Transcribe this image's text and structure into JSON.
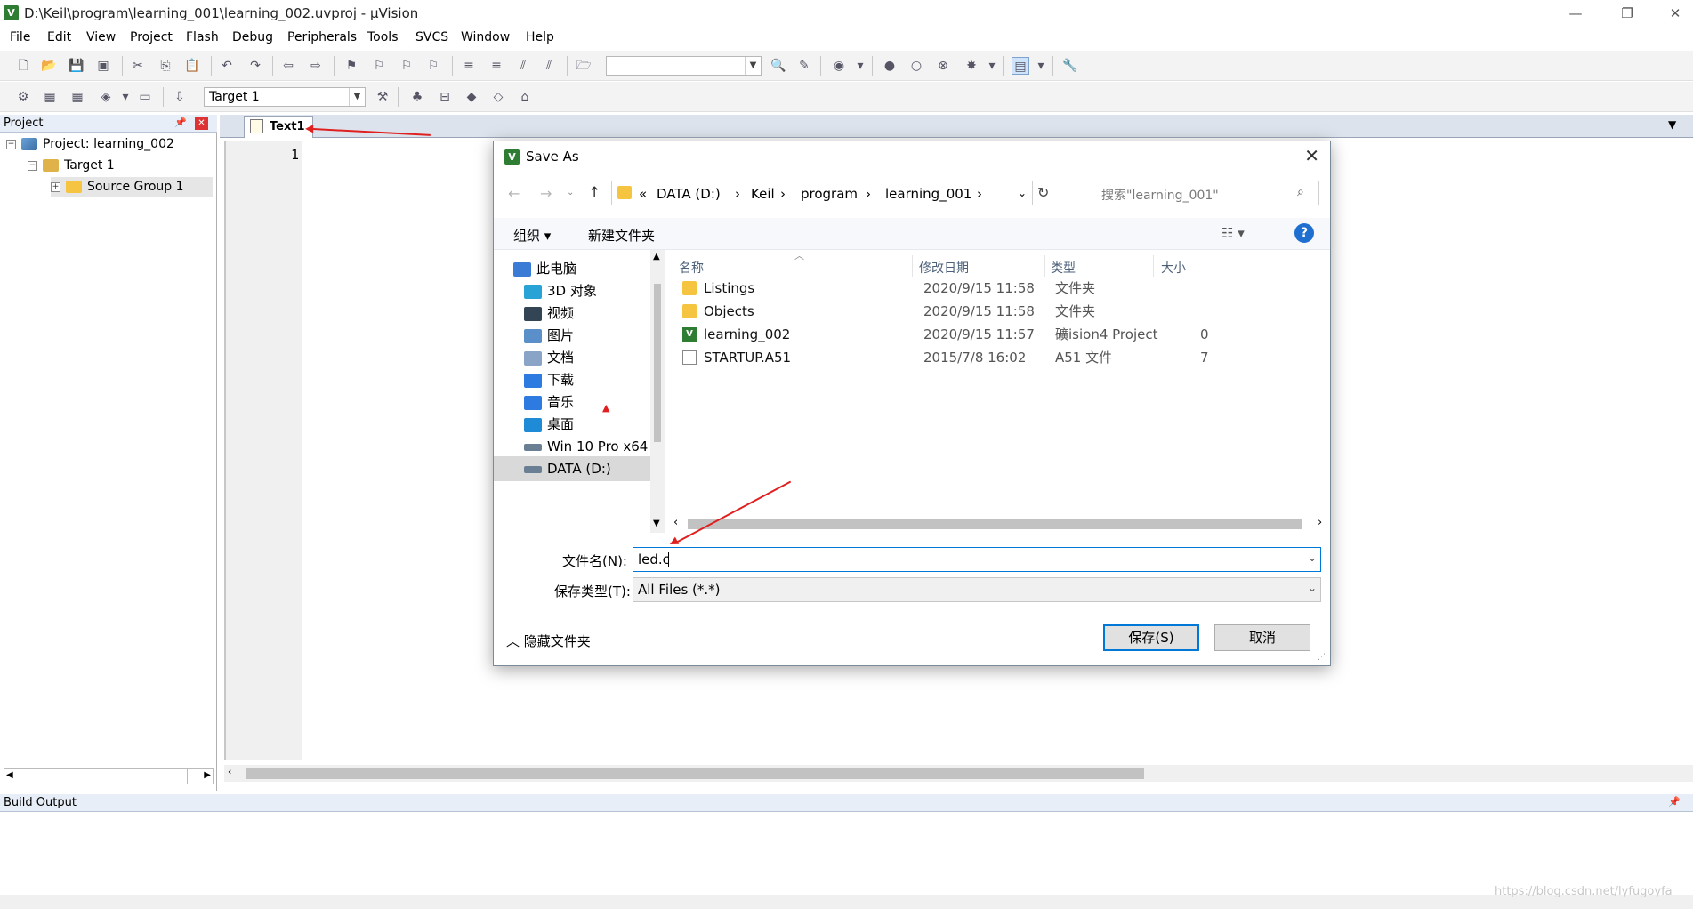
{
  "window": {
    "title": "D:\\Keil\\program\\learning_001\\learning_002.uvproj - µVision",
    "app_icon": "V",
    "controls": [
      "—",
      "❐",
      "✕"
    ]
  },
  "menu": [
    "File",
    "Edit",
    "View",
    "Project",
    "Flash",
    "Debug",
    "Peripherals",
    "Tools",
    "SVCS",
    "Window",
    "Help"
  ],
  "toolbar2": {
    "target_select": "Target 1"
  },
  "project_panel": {
    "title": "Project",
    "pin": "📌",
    "close": "✕",
    "tree": [
      {
        "label": "Project: learning_002",
        "expander": "−"
      },
      {
        "label": "Target 1",
        "expander": "−"
      },
      {
        "label": "Source Group 1",
        "expander": "+"
      }
    ]
  },
  "editor": {
    "tab_label": "Text1",
    "line_numbers": [
      "1"
    ]
  },
  "build_output": {
    "title": "Build Output"
  },
  "dialog": {
    "title": "Save As",
    "breadcrumb": [
      "«",
      "DATA (D:)",
      "›",
      "Keil",
      "›",
      "program",
      "›",
      "learning_001",
      "›"
    ],
    "search_placeholder": "搜索\"learning_001\"",
    "organize_label": "组织 ▾",
    "new_folder_label": "新建文件夹",
    "help_icon": "?",
    "nav_items": [
      {
        "label": "此电脑",
        "icon": "computer-icon",
        "color": "#3a7bd5"
      },
      {
        "label": "3D 对象",
        "icon": "cube-icon",
        "color": "#29a3d6"
      },
      {
        "label": "视频",
        "icon": "video-icon",
        "color": "#334455"
      },
      {
        "label": "图片",
        "icon": "picture-icon",
        "color": "#5b8fc9"
      },
      {
        "label": "文档",
        "icon": "document-icon",
        "color": "#8aa4c8"
      },
      {
        "label": "下载",
        "icon": "download-icon",
        "color": "#2d7be0"
      },
      {
        "label": "音乐",
        "icon": "music-icon",
        "color": "#2d7be0"
      },
      {
        "label": "桌面",
        "icon": "desktop-icon",
        "color": "#1f8ad6"
      },
      {
        "label": "Win 10 Pro x64",
        "icon": "drive-icon",
        "color": "#6a7f94"
      },
      {
        "label": "DATA (D:)",
        "icon": "drive-icon",
        "color": "#6a7f94"
      }
    ],
    "columns": [
      "名称",
      "修改日期",
      "类型",
      "大小"
    ],
    "files": [
      {
        "name": "Listings",
        "date": "2020/9/15 11:58",
        "type": "文件夹",
        "size": "",
        "icon": "folder-icon"
      },
      {
        "name": "Objects",
        "date": "2020/9/15 11:58",
        "type": "文件夹",
        "size": "",
        "icon": "folder-icon"
      },
      {
        "name": "learning_002",
        "date": "2020/9/15 11:57",
        "type": "礦ision4 Project",
        "size": "0",
        "icon": "uvision-project-icon"
      },
      {
        "name": "STARTUP.A51",
        "date": "2015/7/8 16:02",
        "type": "A51 文件",
        "size": "7",
        "icon": "file-icon"
      }
    ],
    "filename_label": "文件名(N):",
    "filename_value": "led.c",
    "filetype_label": "保存类型(T):",
    "filetype_value": "All Files (*.*)",
    "hide_folders_label": "隐藏文件夹",
    "save_button": "保存(S)",
    "cancel_button": "取消"
  },
  "watermark": "https://blog.csdn.net/lyfugoyfa",
  "colors": {
    "annotation_arrow": "#e02020",
    "accent_blue": "#0078d7",
    "folder_yellow": "#f5c542"
  }
}
